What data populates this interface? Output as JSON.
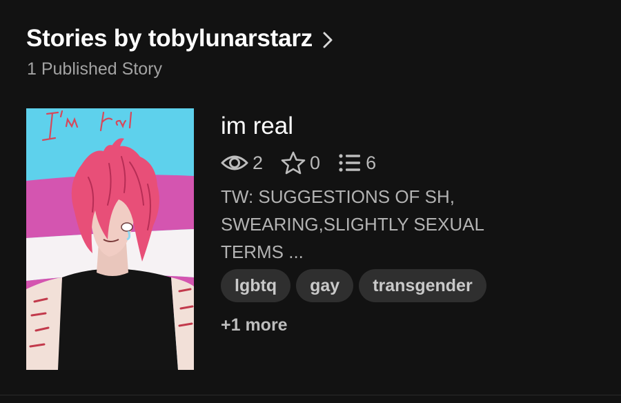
{
  "header": {
    "title": "Stories by tobylunarstarz",
    "subtitle": "1 Published Story"
  },
  "story": {
    "cover_text": "I'm real",
    "title": "im real",
    "stats": {
      "reads": "2",
      "votes": "0",
      "parts": "6"
    },
    "description_lines": [
      "TW: SUGGESTIONS OF SH,",
      "SWEARING,SLIGHTLY SEXUAL",
      "TERMS ..."
    ],
    "tags": [
      "lgbtq",
      "gay",
      "transgender"
    ],
    "more_tags": "+1 more"
  },
  "icons": {
    "header_chevron": "chevron-right-icon",
    "reads": "eye-icon",
    "votes": "star-icon",
    "parts": "list-icon"
  },
  "colors": {
    "background": "#121212",
    "text_primary": "#ffffff",
    "text_secondary": "#a3a3a3",
    "tag_background": "#2f2f2f",
    "cover_trans_blue": "#5ed1ec",
    "cover_trans_pink": "#d455b0",
    "cover_hair": "#e84f78"
  }
}
